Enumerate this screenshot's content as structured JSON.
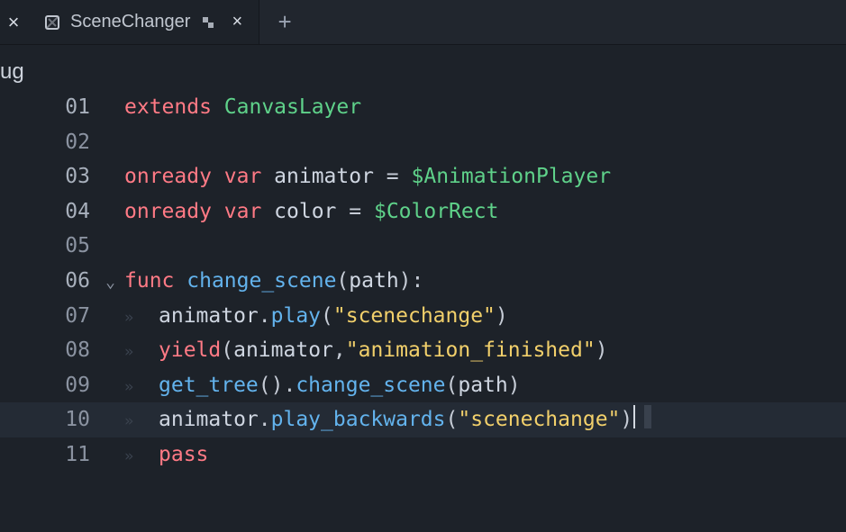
{
  "tabbar": {
    "prev_tab_close": "×",
    "active_tab": {
      "title": "SceneChanger",
      "close": "×"
    },
    "add_tab": "+"
  },
  "left_truncated_label": "ug",
  "editor": {
    "filename": "SceneChanger",
    "language": "gdscript",
    "cursor_line": 10,
    "lines": [
      {
        "n": "01",
        "indent": 0,
        "exec": true,
        "tokens": [
          {
            "t": "extends ",
            "c": "kw-red"
          },
          {
            "t": "CanvasLayer",
            "c": "type"
          }
        ]
      },
      {
        "n": "02",
        "indent": 0,
        "exec": false,
        "tokens": []
      },
      {
        "n": "03",
        "indent": 0,
        "exec": true,
        "tokens": [
          {
            "t": "onready ",
            "c": "kw-red"
          },
          {
            "t": "var ",
            "c": "kw-red"
          },
          {
            "t": "animator ",
            "c": "ident"
          },
          {
            "t": "= ",
            "c": "punct"
          },
          {
            "t": "$AnimationPlayer",
            "c": "ident-y"
          }
        ]
      },
      {
        "n": "04",
        "indent": 0,
        "exec": true,
        "tokens": [
          {
            "t": "onready ",
            "c": "kw-red"
          },
          {
            "t": "var ",
            "c": "kw-red"
          },
          {
            "t": "color ",
            "c": "ident"
          },
          {
            "t": "= ",
            "c": "punct"
          },
          {
            "t": "$ColorRect",
            "c": "ident-y"
          }
        ]
      },
      {
        "n": "05",
        "indent": 0,
        "exec": false,
        "tokens": []
      },
      {
        "n": "06",
        "indent": 0,
        "exec": true,
        "fold": true,
        "tokens": [
          {
            "t": "func ",
            "c": "kw-red"
          },
          {
            "t": "change_scene",
            "c": "fn-def"
          },
          {
            "t": "(",
            "c": "punct"
          },
          {
            "t": "path",
            "c": "ident"
          },
          {
            "t": "):",
            "c": "punct"
          }
        ]
      },
      {
        "n": "07",
        "indent": 1,
        "exec": false,
        "tokens": [
          {
            "t": "animator",
            "c": "ident"
          },
          {
            "t": ".",
            "c": "punct"
          },
          {
            "t": "play",
            "c": "fn-blue"
          },
          {
            "t": "(",
            "c": "punct"
          },
          {
            "t": "\"scenechange\"",
            "c": "string"
          },
          {
            "t": ")",
            "c": "punct"
          }
        ]
      },
      {
        "n": "08",
        "indent": 1,
        "exec": false,
        "tokens": [
          {
            "t": "yield",
            "c": "kw-red"
          },
          {
            "t": "(",
            "c": "punct"
          },
          {
            "t": "animator",
            "c": "ident"
          },
          {
            "t": ",",
            "c": "punct"
          },
          {
            "t": "\"animation_finished\"",
            "c": "sig"
          },
          {
            "t": ")",
            "c": "punct"
          }
        ]
      },
      {
        "n": "09",
        "indent": 1,
        "exec": false,
        "tokens": [
          {
            "t": "get_tree",
            "c": "fn-blue"
          },
          {
            "t": "().",
            "c": "punct"
          },
          {
            "t": "change_scene",
            "c": "fn-blue"
          },
          {
            "t": "(",
            "c": "punct"
          },
          {
            "t": "path",
            "c": "ident"
          },
          {
            "t": ")",
            "c": "punct"
          }
        ]
      },
      {
        "n": "10",
        "indent": 1,
        "exec": false,
        "current": true,
        "tokens": [
          {
            "t": "animator",
            "c": "ident"
          },
          {
            "t": ".",
            "c": "punct"
          },
          {
            "t": "play_backwards",
            "c": "fn-blue"
          },
          {
            "t": "(",
            "c": "punct"
          },
          {
            "t": "\"scenechange\"",
            "c": "string"
          },
          {
            "t": ")",
            "c": "punct"
          }
        ],
        "caret_after": true
      },
      {
        "n": "11",
        "indent": 1,
        "exec": false,
        "tokens": [
          {
            "t": "pass",
            "c": "kw-red"
          }
        ]
      }
    ]
  }
}
